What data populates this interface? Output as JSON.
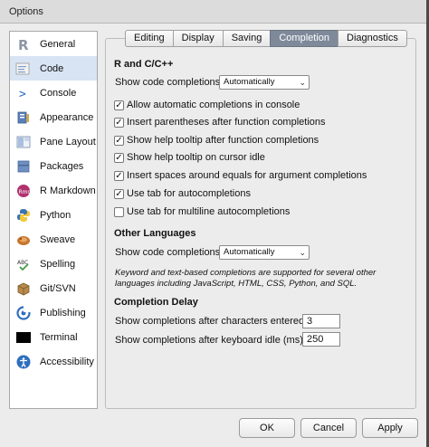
{
  "window": {
    "title": "Options"
  },
  "sidebar": {
    "items": [
      {
        "label": "General",
        "icon": "r-logo-icon"
      },
      {
        "label": "Code",
        "icon": "code-icon"
      },
      {
        "label": "Console",
        "icon": "console-icon"
      },
      {
        "label": "Appearance",
        "icon": "appearance-icon"
      },
      {
        "label": "Pane Layout",
        "icon": "pane-layout-icon"
      },
      {
        "label": "Packages",
        "icon": "packages-icon"
      },
      {
        "label": "R Markdown",
        "icon": "rmarkdown-icon"
      },
      {
        "label": "Python",
        "icon": "python-icon"
      },
      {
        "label": "Sweave",
        "icon": "sweave-icon"
      },
      {
        "label": "Spelling",
        "icon": "spelling-icon"
      },
      {
        "label": "Git/SVN",
        "icon": "git-icon"
      },
      {
        "label": "Publishing",
        "icon": "publishing-icon"
      },
      {
        "label": "Terminal",
        "icon": "terminal-icon"
      },
      {
        "label": "Accessibility",
        "icon": "accessibility-icon"
      }
    ],
    "selected": "Code"
  },
  "tabs": [
    "Editing",
    "Display",
    "Saving",
    "Completion",
    "Diagnostics"
  ],
  "active_tab": "Completion",
  "r_section": {
    "heading": "R and C/C++",
    "show_label": "Show code completions:",
    "show_value": "Automatically",
    "options": [
      {
        "label": "Allow automatic completions in console",
        "checked": true
      },
      {
        "label": "Insert parentheses after function completions",
        "checked": true
      },
      {
        "label": "Show help tooltip after function completions",
        "checked": true
      },
      {
        "label": "Show help tooltip on cursor idle",
        "checked": true
      },
      {
        "label": "Insert spaces around equals for argument completions",
        "checked": true
      },
      {
        "label": "Use tab for autocompletions",
        "checked": true
      },
      {
        "label": "Use tab for multiline autocompletions",
        "checked": false
      }
    ]
  },
  "other_section": {
    "heading": "Other Languages",
    "show_label": "Show code completions:",
    "show_value": "Automatically",
    "note": "Keyword and text-based completions are supported for several other languages including JavaScript, HTML, CSS, Python, and SQL."
  },
  "delay_section": {
    "heading": "Completion Delay",
    "chars_label": "Show completions after characters entered:",
    "chars_value": "3",
    "idle_label": "Show completions after keyboard idle (ms):",
    "idle_value": "250"
  },
  "buttons": {
    "ok": "OK",
    "cancel": "Cancel",
    "apply": "Apply"
  },
  "colors": {
    "active_tab": "#7e8a9a",
    "selected_item": "#d8e4f3"
  }
}
